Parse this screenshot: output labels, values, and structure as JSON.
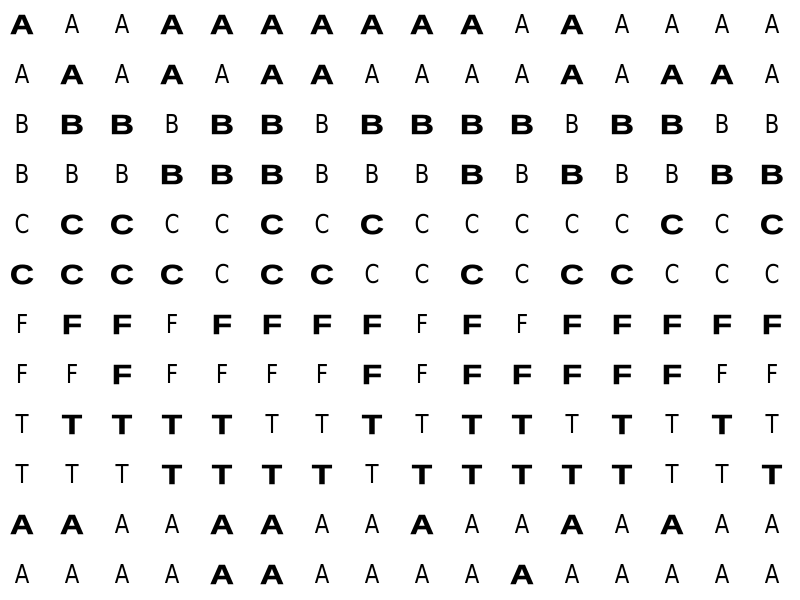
{
  "grid": {
    "rows": [
      {
        "letter": "A",
        "bold": [
          1,
          0,
          0,
          1,
          1,
          1,
          1,
          1,
          1,
          1,
          0,
          1,
          0,
          0,
          0,
          0
        ]
      },
      {
        "letter": "A",
        "bold": [
          0,
          1,
          0,
          1,
          0,
          1,
          1,
          0,
          0,
          0,
          0,
          1,
          0,
          1,
          1,
          0
        ]
      },
      {
        "letter": "B",
        "bold": [
          0,
          1,
          1,
          0,
          1,
          1,
          0,
          1,
          1,
          1,
          1,
          0,
          1,
          1,
          0,
          0
        ]
      },
      {
        "letter": "B",
        "bold": [
          0,
          0,
          0,
          1,
          1,
          1,
          0,
          0,
          0,
          1,
          0,
          1,
          0,
          0,
          1,
          1
        ]
      },
      {
        "letter": "C",
        "bold": [
          0,
          1,
          1,
          0,
          0,
          1,
          0,
          1,
          0,
          0,
          0,
          0,
          0,
          1,
          0,
          1
        ]
      },
      {
        "letter": "C",
        "bold": [
          1,
          1,
          1,
          1,
          0,
          1,
          1,
          0,
          0,
          1,
          0,
          1,
          1,
          0,
          0,
          0
        ]
      },
      {
        "letter": "F",
        "bold": [
          0,
          1,
          1,
          0,
          1,
          1,
          1,
          1,
          0,
          1,
          0,
          1,
          1,
          1,
          1,
          1
        ]
      },
      {
        "letter": "F",
        "bold": [
          0,
          0,
          1,
          0,
          0,
          0,
          0,
          1,
          0,
          1,
          1,
          1,
          1,
          1,
          0,
          0
        ]
      },
      {
        "letter": "T",
        "bold": [
          0,
          1,
          1,
          1,
          1,
          0,
          0,
          1,
          0,
          1,
          1,
          0,
          1,
          0,
          1,
          0
        ]
      },
      {
        "letter": "T",
        "bold": [
          0,
          0,
          0,
          1,
          1,
          1,
          1,
          0,
          1,
          1,
          1,
          1,
          1,
          0,
          0,
          1
        ]
      },
      {
        "letter": "A",
        "bold": [
          1,
          1,
          0,
          0,
          1,
          1,
          0,
          0,
          1,
          0,
          0,
          1,
          0,
          1,
          0,
          0
        ]
      },
      {
        "letter": "A",
        "bold": [
          0,
          0,
          0,
          0,
          1,
          1,
          0,
          0,
          0,
          0,
          1,
          0,
          0,
          0,
          0,
          0
        ]
      }
    ]
  }
}
